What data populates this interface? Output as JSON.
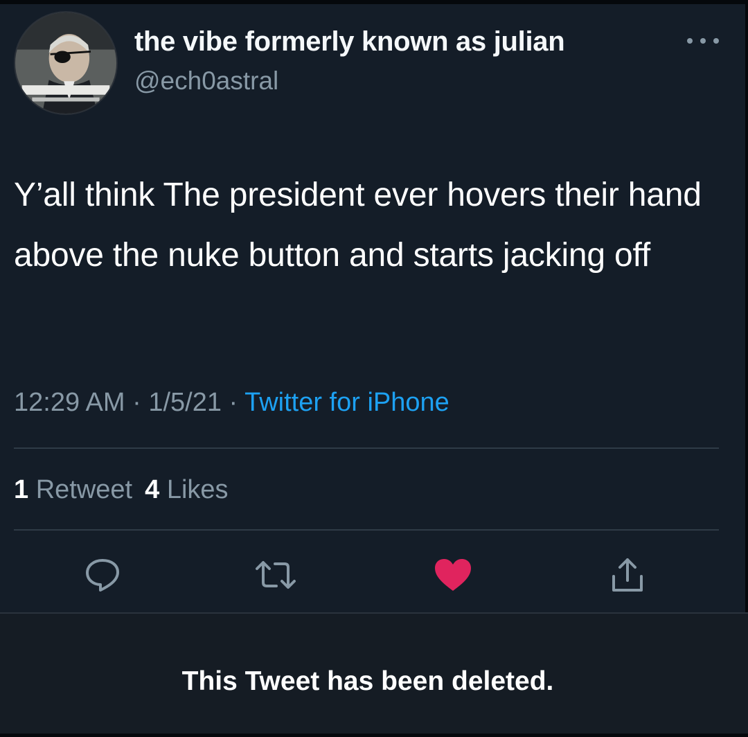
{
  "tweet": {
    "display_name": "the vibe formerly known as julian",
    "handle": "@ech0astral",
    "text": "Y’all think The president ever hovers their hand above the nuke button and starts jacking off",
    "time": "12:29 AM",
    "date": "1/5/21",
    "separator": " · ",
    "source": "Twitter for iPhone",
    "retweets_count": "1",
    "retweets_label": "Retweet",
    "likes_count": "4",
    "likes_label": "Likes",
    "liked": true
  },
  "actions": {
    "reply_icon": "reply-icon",
    "retweet_icon": "retweet-icon",
    "like_icon": "heart-icon",
    "share_icon": "share-icon"
  },
  "notice": {
    "text": "This Tweet has been deleted."
  },
  "colors": {
    "background": "#141d28",
    "link": "#1da1f2",
    "secondary_text": "#8899a6",
    "like": "#e0245e"
  }
}
